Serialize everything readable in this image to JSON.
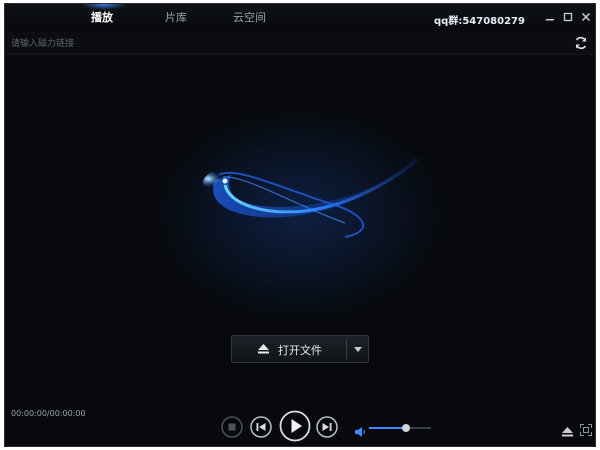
{
  "header": {
    "tabs": [
      {
        "label": "播放",
        "active": true
      },
      {
        "label": "片库",
        "active": false
      },
      {
        "label": "云空间",
        "active": false
      }
    ],
    "qq_group": "qq群:547080279",
    "window_controls": [
      "minimize-icon",
      "maximize-icon",
      "close-icon"
    ]
  },
  "urlbar": {
    "placeholder": "请输入磁力链接",
    "value": "",
    "refresh_icon": "refresh-icon"
  },
  "main": {
    "open_button": {
      "icon": "eject-icon",
      "label": "打开文件",
      "dropdown_icon": "chevron-down-icon"
    }
  },
  "playback": {
    "time": "00:00:00/00:00:00",
    "volume_level": 0.6,
    "controls": [
      "stop-icon",
      "previous-icon",
      "play-icon",
      "next-icon",
      "volume-icon",
      "eject-icon",
      "fullscreen-icon"
    ]
  },
  "colors": {
    "background": "#07090c",
    "accent": "#3d8bff",
    "text": "#e6ebf0"
  }
}
